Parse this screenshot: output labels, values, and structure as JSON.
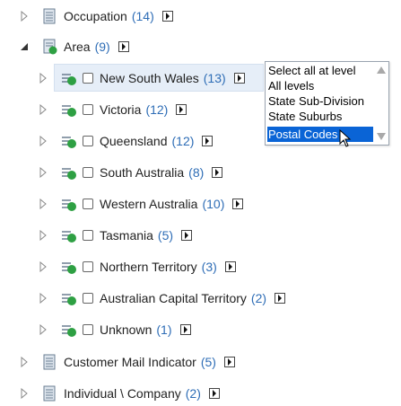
{
  "tree": {
    "rows": [
      {
        "label": "Occupation",
        "count": "(14)"
      },
      {
        "label": "Area",
        "count": "(9)"
      },
      {
        "label": "New South Wales",
        "count": "(13)"
      },
      {
        "label": "Victoria",
        "count": "(12)"
      },
      {
        "label": "Queensland",
        "count": "(12)"
      },
      {
        "label": "South Australia",
        "count": "(8)"
      },
      {
        "label": "Western Australia",
        "count": "(10)"
      },
      {
        "label": "Tasmania",
        "count": "(5)"
      },
      {
        "label": "Northern Territory",
        "count": "(3)"
      },
      {
        "label": "Australian Capital Territory",
        "count": "(2)"
      },
      {
        "label": "Unknown",
        "count": "(1)"
      },
      {
        "label": "Customer Mail Indicator",
        "count": "(5)"
      },
      {
        "label": "Individual \\ Company",
        "count": "(2)"
      }
    ]
  },
  "dropdown": {
    "items": [
      "Select all at level",
      "All levels",
      "State Sub-Division",
      "State Suburbs",
      "Postal Codes"
    ],
    "selected": "Postal Codes"
  },
  "colors": {
    "count": "#2e6db6",
    "highlight": "#0a64d6",
    "row_selected": "#e6eef8",
    "area_icon_green": "#2ea043"
  }
}
